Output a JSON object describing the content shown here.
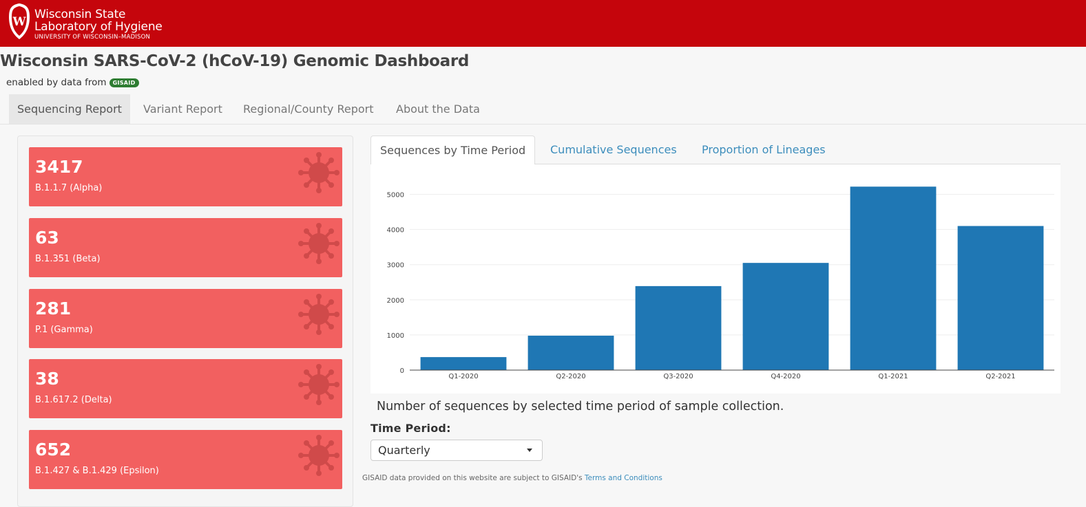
{
  "header": {
    "brand_line1": "Wisconsin State",
    "brand_line2": "Laboratory of Hygiene",
    "brand_line3": "UNIVERSITY OF WISCONSIN–MADISON",
    "crest_letter": "W",
    "bg_color": "#c5050c"
  },
  "page": {
    "title": "Wisconsin SARS-CoV-2 (hCoV-19) Genomic Dashboard",
    "subtitle": "enabled by data from",
    "badge": "GISAID"
  },
  "nav": {
    "items": [
      {
        "label": "Sequencing Report"
      },
      {
        "label": "Variant Report"
      },
      {
        "label": "Regional/County Report"
      },
      {
        "label": "About the Data"
      }
    ]
  },
  "variants": [
    {
      "count": "3417",
      "name": "B.1.1.7 (Alpha)"
    },
    {
      "count": "63",
      "name": "B.1.351 (Beta)"
    },
    {
      "count": "281",
      "name": "P.1 (Gamma)"
    },
    {
      "count": "38",
      "name": "B.1.617.2 (Delta)"
    },
    {
      "count": "652",
      "name": "B.1.427 & B.1.429 (Epsilon)"
    }
  ],
  "variant_box_color": "#f26060",
  "tabs": [
    {
      "label": "Sequences by Time Period"
    },
    {
      "label": "Cumulative Sequences"
    },
    {
      "label": "Proportion of Lineages"
    }
  ],
  "chart_caption": "Number of sequences by selected time period of sample collection.",
  "time_period": {
    "label": "Time Period:",
    "selected": "Quarterly"
  },
  "footer": {
    "text": "GISAID data provided on this website are subject to GISAID's",
    "link": "Terms and Conditions"
  },
  "chart_data": {
    "type": "bar",
    "categories": [
      "Q1-2020",
      "Q2-2020",
      "Q3-2020",
      "Q4-2020",
      "Q1-2021",
      "Q2-2021"
    ],
    "values": [
      370,
      980,
      2390,
      3050,
      5220,
      4100
    ],
    "yticks": [
      0,
      1000,
      2000,
      3000,
      4000,
      5000
    ],
    "ylim": [
      0,
      5500
    ],
    "grid": true,
    "bar_color": "#1f77b4",
    "title": "",
    "xlabel": "",
    "ylabel": ""
  }
}
